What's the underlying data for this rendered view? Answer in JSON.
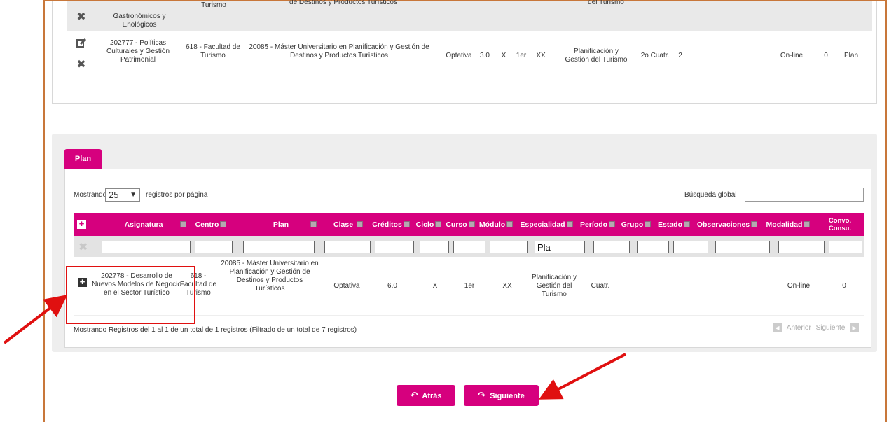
{
  "top_rows": [
    {
      "asignatura": "Gastronómicos y Enológicos",
      "centro_fragment": "Turismo",
      "plan_fragment": "de Destinos y Productos Turísticos",
      "especialidad_fragment": "del Turismo"
    },
    {
      "asignatura": "202777 - Políticas Culturales y Gestión Patrimonial",
      "centro": "618 - Facultad de Turismo",
      "plan": "20085 - Máster Universitario en Planificación y Gestión de Destinos y Productos Turísticos",
      "clase": "Optativa",
      "creditos": "3.0",
      "ciclo": "X",
      "curso": "1er",
      "modulo": "XX",
      "especialidad": "Planificación y Gestión del Turismo",
      "periodo": "2o Cuatr.",
      "grupo": "2",
      "modalidad": "On-line",
      "convocatoria": "0",
      "observaciones": "Plan"
    }
  ],
  "plan_section": {
    "tab_label": "Plan",
    "length_prefix": "Mostrando",
    "length_value": "25",
    "length_suffix": "registros por página",
    "search_label": "Búsqueda global",
    "search_value": "",
    "columns": [
      "Asignatura",
      "Centro",
      "Plan",
      "Clase",
      "Créditos",
      "Ciclo",
      "Curso",
      "Módulo",
      "Especialidad",
      "Período",
      "Grupo",
      "Estado",
      "Observaciones",
      "Modalidad",
      "Convo. Consu."
    ],
    "filter_especialidad": "Pla",
    "row": {
      "asignatura": "202778 - Desarrollo de Nuevos Modelos de Negocio en el Sector Turístico",
      "centro": "618 - Facultad de Turismo",
      "plan": "20085 - Máster Universitario en Planificación y Gestión de Destinos y Productos Turísticos",
      "clase": "Optativa",
      "creditos": "6.0",
      "ciclo": "X",
      "curso": "1er",
      "modulo": "XX",
      "especialidad": "Planificación y Gestión del Turismo",
      "periodo": "Cuatr.",
      "modalidad": "On-line",
      "convocatoria": "0"
    },
    "info": "Mostrando Registros del 1 al 1 de un total de 1 registros (Filtrado de un total de 7 registros)",
    "prev_label": "Anterior",
    "next_label": "Siguiente"
  },
  "buttons": {
    "back": "Atrás",
    "next": "Siguiente"
  },
  "colors": {
    "accent": "#d6007e",
    "frame": "#c8773a",
    "annotation": "#e01010"
  }
}
